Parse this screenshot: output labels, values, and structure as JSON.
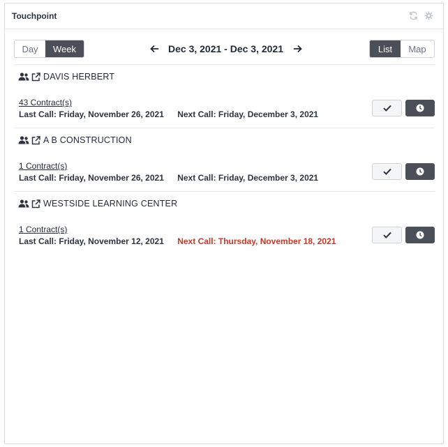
{
  "panel": {
    "title": "Touchpoint",
    "icons": [
      "refresh-icon",
      "gear-icon"
    ]
  },
  "toolbar": {
    "range_buttons": [
      {
        "label": "Day",
        "active": false
      },
      {
        "label": "Week",
        "active": true
      }
    ],
    "date_range": "Dec 3, 2021 - Dec 3, 2021",
    "view_buttons": [
      {
        "label": "List",
        "active": true
      },
      {
        "label": "Map",
        "active": false
      }
    ]
  },
  "items": [
    {
      "name": "DAVIS HERBERT",
      "contracts": "43 Contract(s)",
      "last_call": "Last Call: Friday, November 26, 2021",
      "next_call": "Next Call: Friday, December 3, 2021",
      "next_overdue": false
    },
    {
      "name": "A B CONSTRUCTION",
      "contracts": "1 Contract(s)",
      "last_call": "Last Call: Friday, November 26, 2021",
      "next_call": "Next Call: Friday, December 3, 2021",
      "next_overdue": false
    },
    {
      "name": "WESTSIDE LEARNING CENTER",
      "contracts": "1 Contract(s)",
      "last_call": "Last Call: Friday, November 12, 2021",
      "next_call": "Next Call: Thursday, November 18, 2021",
      "next_overdue": true
    }
  ],
  "colors": {
    "accent_dark": "#4a4f58",
    "overdue": "#c0392b",
    "border": "#d9dbdf"
  }
}
